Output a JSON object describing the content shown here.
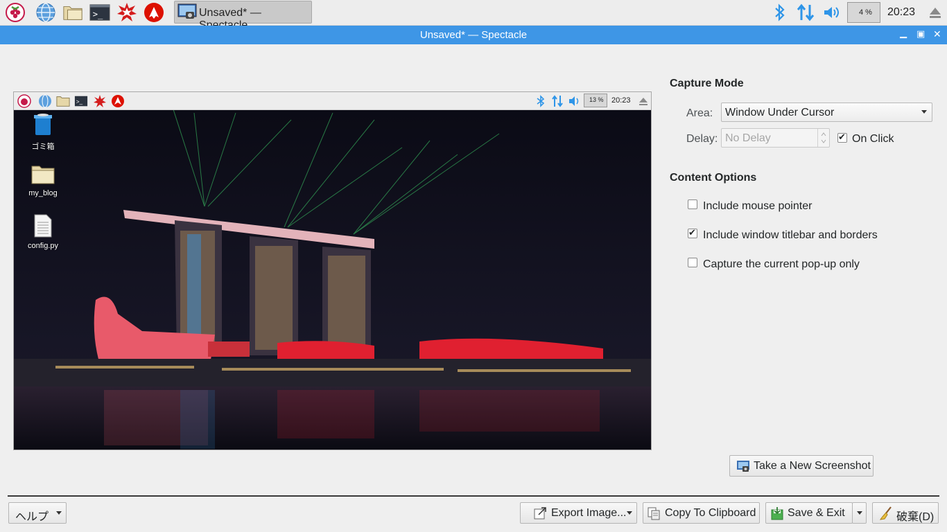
{
  "taskbar": {
    "launchers": [
      "raspberry-menu-icon",
      "web-browser-icon",
      "file-manager-icon",
      "terminal-icon",
      "mathematica-icon",
      "wolfram-icon"
    ],
    "task_label": "Unsaved* — Spectacle",
    "cpu_label": "4 %",
    "clock": "20:23"
  },
  "window": {
    "title": "Unsaved* — Spectacle"
  },
  "preview": {
    "cpu_label": "13 %",
    "clock": "20:23",
    "desktop_icons": [
      "ゴミ箱",
      "my_blog",
      "config.py"
    ]
  },
  "capture_mode": {
    "heading": "Capture Mode",
    "area_label": "Area:",
    "area_value": "Window Under Cursor",
    "delay_label": "Delay:",
    "delay_value": "No Delay",
    "on_click_label": "On Click",
    "on_click_checked": true
  },
  "content_options": {
    "heading": "Content Options",
    "options": [
      {
        "label": "Include mouse pointer",
        "checked": false
      },
      {
        "label": "Include window titlebar and borders",
        "checked": true
      },
      {
        "label": "Capture the current pop-up only",
        "checked": false
      }
    ]
  },
  "actions": {
    "new_screenshot": "Take a New Screenshot",
    "help": "ヘルプ",
    "export": "Export Image...",
    "copy": "Copy To Clipboard",
    "save_exit": "Save & Exit",
    "discard": "破棄(D)"
  },
  "colors": {
    "titlebar": "#3e96e6",
    "accent": "#2e95e8"
  }
}
